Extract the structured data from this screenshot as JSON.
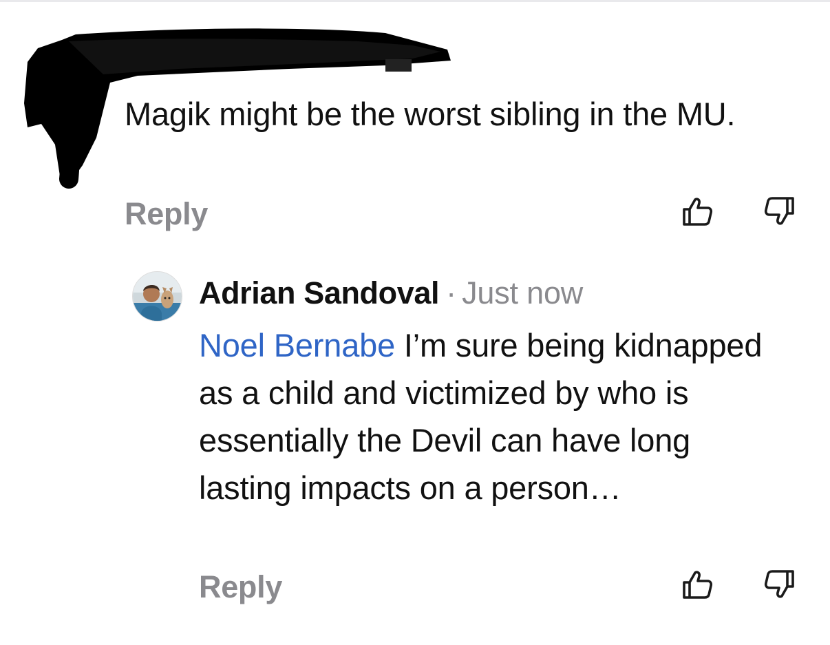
{
  "comment": {
    "text": "Magik might be the worst sibling in the MU.",
    "reply_label": "Reply",
    "like_icon": "thumbs-up-icon",
    "dislike_icon": "thumbs-down-icon"
  },
  "reply": {
    "author": "Adrian Sandoval",
    "separator": "·",
    "timestamp": "Just now",
    "mention": "Noel Bernabe",
    "text": " I’m sure being kidnapped as a child and victimized by who is essentially the Devil can have long lasting impacts on a person…",
    "reply_label": "Reply",
    "avatar_icon": "profile-photo",
    "like_icon": "thumbs-up-icon",
    "dislike_icon": "thumbs-down-icon"
  },
  "colors": {
    "text": "#111111",
    "muted": "#8a8a8e",
    "mention": "#2f65c6",
    "redaction": "#000000"
  }
}
